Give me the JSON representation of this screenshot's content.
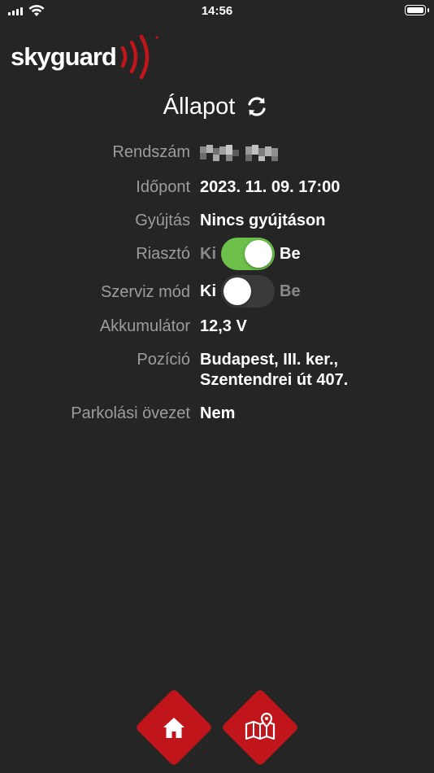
{
  "status_bar": {
    "time": "14:56"
  },
  "brand": {
    "name": "skyguard",
    "accent_color": "#c0161b"
  },
  "page": {
    "title": "Állapot",
    "refresh_icon": "refresh-icon"
  },
  "fields": {
    "plate_label": "Rendszám",
    "time_label": "Időpont",
    "time_value": "2023. 11. 09. 17:00",
    "ignition_label": "Gyújtás",
    "ignition_value": "Nincs gyújtáson",
    "alarm_label": "Riasztó",
    "alarm_off": "Ki",
    "alarm_on": "Be",
    "alarm_state": true,
    "service_label": "Szerviz mód",
    "service_off": "Ki",
    "service_on": "Be",
    "service_state": false,
    "battery_label": "Akkumulátor",
    "battery_value": "12,3 V",
    "position_label": "Pozíció",
    "position_line1": "Budapest, III. ker.,",
    "position_line2": "Szentendrei út 407.",
    "parking_label": "Parkolási övezet",
    "parking_value": "Nem"
  },
  "colors": {
    "switch_on": "#6cc04a",
    "switch_off": "#3a3a3a"
  },
  "nav": {
    "home_icon": "home-icon",
    "map_icon": "map-pin-icon"
  }
}
